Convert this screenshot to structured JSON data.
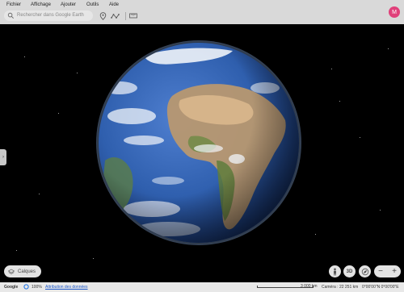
{
  "menu": [
    "Fichier",
    "Affichage",
    "Ajouter",
    "Outils",
    "Aide"
  ],
  "search": {
    "placeholder": "Rechercher dans Google Earth"
  },
  "account": {
    "initial": "M"
  },
  "layers_button": {
    "label": "Calques"
  },
  "status": {
    "brand": "Google",
    "zoom": "100%",
    "attribution": "Attribution des données",
    "scale": "3 000 km",
    "camera": "Caméra : 22 251 km",
    "coords": "0°00'00\"N 0°00'00\"E"
  },
  "colors": {
    "accent_avatar": "#e0407a",
    "link": "#1a56c9"
  }
}
